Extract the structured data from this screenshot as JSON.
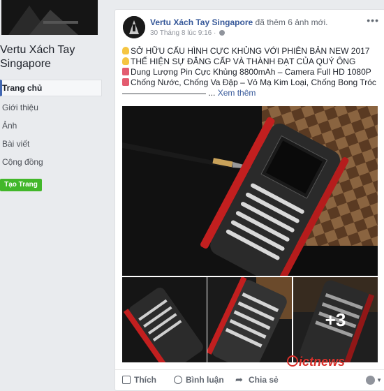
{
  "sidebar": {
    "page_name": "Vertu Xách Tay Singapore",
    "nav": [
      "Trang chủ",
      "Giới thiệu",
      "Ảnh",
      "Bài viết",
      "Cộng đồng"
    ],
    "create_button": "Tạo Trang"
  },
  "post": {
    "author": "Vertu Xách Tay Singapore",
    "action": "đã thêm 6 ảnh mới.",
    "timestamp": "30 Tháng 8 lúc 9:16 ·",
    "lines": [
      "SỞ HỮU CẤU HÌNH CỰC KHỦNG VỚI PHIÊN BẢN NEW 2017",
      "THỂ HIỆN SỰ ĐẲNG CẤP VÀ THÀNH ĐẠT CỦA QUÝ ÔNG",
      "Dung Lượng Pin Cực Khủng 8800mAh – Camera Full HD 1080P",
      "Chống Nước, Chống Va Đập – Vỏ Mạ Kim Loại, Chống Bong Tróc"
    ],
    "ellipsis": "—————————— ...",
    "see_more": "Xem thêm",
    "more_photos": "+3",
    "watermark": "ictnews"
  },
  "actions": {
    "like": "Thích",
    "comment": "Bình luận",
    "share": "Chia sẻ"
  },
  "colors": {
    "link": "#365899",
    "create_button": "#42b72a",
    "background": "#e9ebee"
  }
}
